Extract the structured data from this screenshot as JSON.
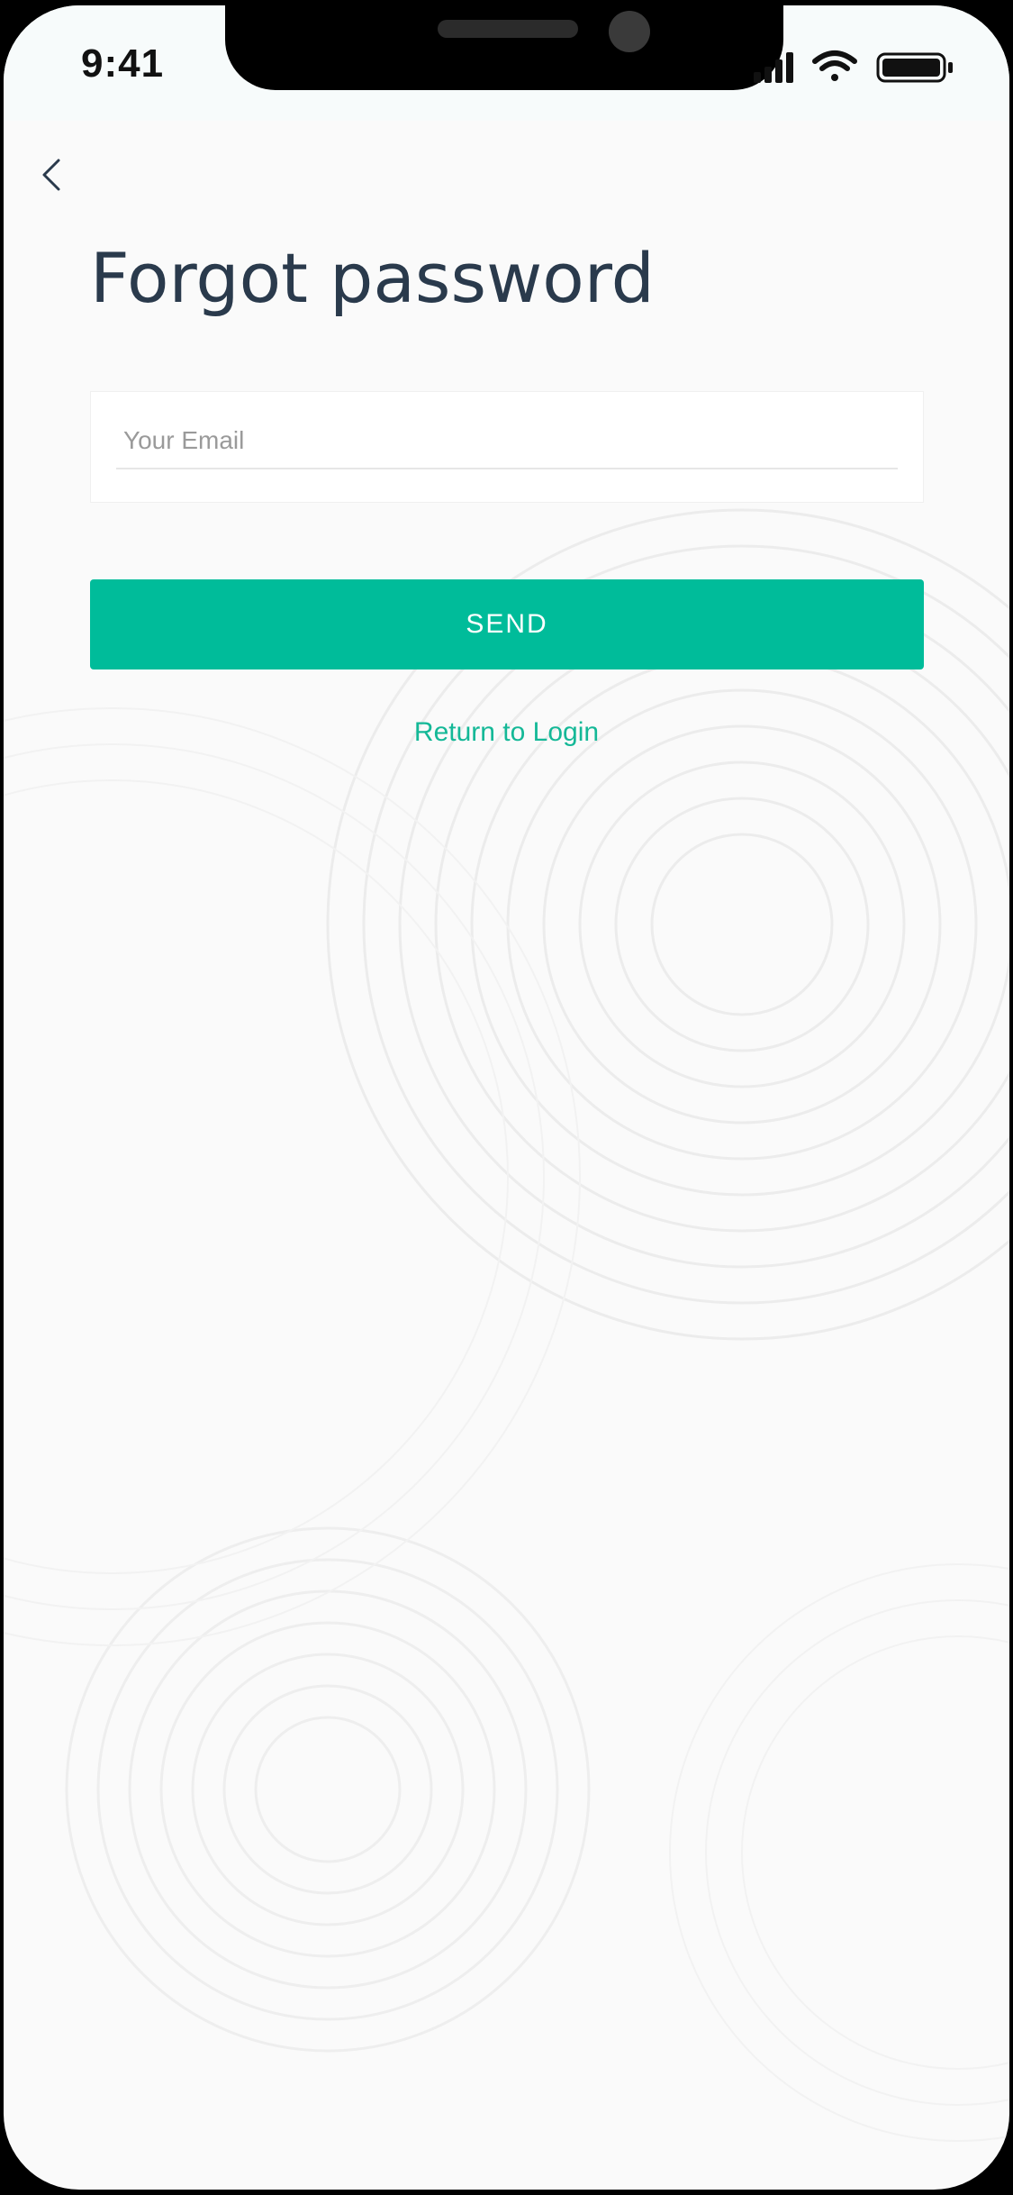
{
  "status_bar": {
    "time": "9:41",
    "icons": [
      "signal-icon",
      "wifi-icon",
      "battery-icon"
    ]
  },
  "nav": {
    "back_icon": "chevron-left-icon"
  },
  "page": {
    "title": "Forgot password"
  },
  "form": {
    "email_value": "",
    "email_placeholder": "Your Email",
    "send_label": "SEND",
    "return_link_label": "Return to Login"
  },
  "colors": {
    "accent": "#00bc9a",
    "link": "#14b897",
    "title": "#2a3a4c",
    "background": "#fafafa"
  }
}
